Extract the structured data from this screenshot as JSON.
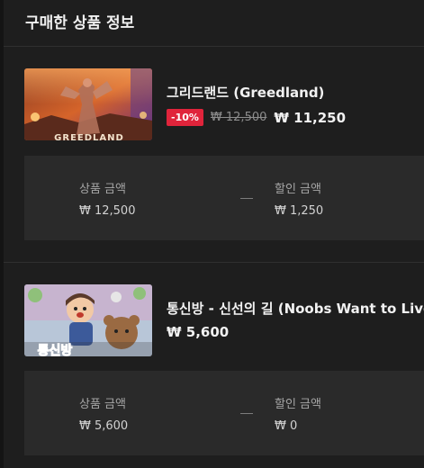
{
  "header": {
    "title": "구매한 상품 정보"
  },
  "products": [
    {
      "name": "그리드랜드 (Greedland)",
      "discount_badge": "-10%",
      "original_price": "₩ 12,500",
      "final_price": "₩ 11,250",
      "thumbnail_text": "GREEDLAND",
      "summary": {
        "product_amount_label": "상품 금액",
        "product_amount_value": "₩ 12,500",
        "discount_amount_label": "할인 금액",
        "discount_amount_value": "₩ 1,250"
      }
    },
    {
      "name": "통신방 - 신선의 길 (Noobs Want to Live)",
      "final_price": "₩ 5,600",
      "thumbnail_text": "통신방",
      "summary": {
        "product_amount_label": "상품 금액",
        "product_amount_value": "₩ 5,600",
        "discount_amount_label": "할인 금액",
        "discount_amount_value": "₩ 0"
      }
    }
  ],
  "colors": {
    "background": "#1e1e1e",
    "panel": "#2a2a2a",
    "discount_badge": "#e0243b"
  }
}
